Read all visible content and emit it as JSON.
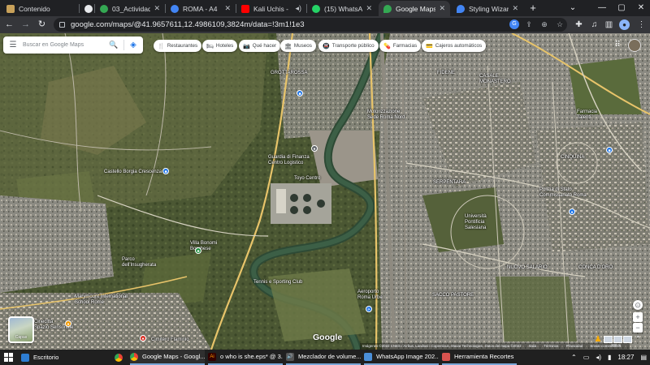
{
  "browser": {
    "tabs": [
      {
        "title": "Contenido",
        "fav_color": "#c8a15a",
        "fav_glyph": ""
      },
      {
        "title": "",
        "fav_color": "#e8eaed",
        "fav_glyph": ""
      },
      {
        "title": "03_Actividad_Ci",
        "fav_color": "#34a853",
        "fav_glyph": ""
      },
      {
        "title": "ROMA - A4",
        "fav_color": "#4285f4",
        "fav_glyph": ""
      },
      {
        "title": "Kali Uchis -",
        "fav_color": "#ff0000",
        "fav_glyph": ""
      },
      {
        "title": "(15) WhatsApp",
        "fav_color": "#25d366",
        "fav_glyph": ""
      },
      {
        "title": "Google Maps",
        "fav_color": "#34a853",
        "fav_glyph": ""
      },
      {
        "title": "Styling Wizard: G",
        "fav_color": "#4285f4",
        "fav_glyph": ""
      }
    ],
    "new_tab": "+",
    "window_controls": [
      "⌄",
      "—",
      "▢",
      "✕"
    ],
    "url": "google.com/maps/@41.9657611,12.4986109,3824m/data=!3m1!1e3"
  },
  "maps": {
    "search_placeholder": "Buscar en Google Maps",
    "chips": [
      {
        "icon": "fork-knife-icon",
        "glyph": "🍴",
        "label": "Restaurantes"
      },
      {
        "icon": "bed-icon",
        "glyph": "🛏",
        "label": "Hoteles"
      },
      {
        "icon": "camera-icon",
        "glyph": "📷",
        "label": "Qué hacer"
      },
      {
        "icon": "museum-icon",
        "glyph": "🏛",
        "label": "Museos"
      },
      {
        "icon": "transit-icon",
        "glyph": "🚇",
        "label": "Transporte público"
      },
      {
        "icon": "pharmacy-icon",
        "glyph": "💊",
        "label": "Farmacias"
      },
      {
        "icon": "atm-icon",
        "glyph": "💳",
        "label": "Cajeros automáticos"
      }
    ],
    "labels": {
      "grottarossa": "GROTTAROSSA",
      "ferrovia": "Motorizzazione\nSede Roma Nord",
      "guardia": "Guardia di Finanza\nCentro Logistico",
      "toyo": "Toyo Centro",
      "castello": "Castello Borgia Crescenza",
      "serpentara": "SERPENTARA",
      "polizia": "Polizia di Stato\nCommissariato Roma",
      "salesiani": "Università\nPontificia\nSalesiana",
      "parco": "Parco\ndell'Insugherata",
      "villa": "Villa Bonomi\nBorghese",
      "marymount": "Marymount International\nSchool Rome",
      "tennis": "Tennis e Sporting Club",
      "romaurbe": "Aeroporto\nRoma Urbe",
      "talenti": "Farmacia\nTalenti",
      "cinecitta": "Cinecittà\nSpazio Sensoriale",
      "cimitero": "Cimitero\nFlaminio",
      "fidene": "FIDENE",
      "casale": "CASALE\nMONASTERO",
      "cinquina": "CINQUINA",
      "conca": "CONCA D'ORO",
      "sacco": "SACCO PASTORE",
      "nuovo": "NUOVO SALARIO"
    },
    "layers_label": "Capas",
    "logo": "Google",
    "attribution": [
      "Imágenes ©2022 CNES / Airbus, Landsat / Copernicus, Maxar Technologies, Datos del mapa ©2022",
      "Italia",
      "Términos",
      "Privacidad",
      "Enviar comentarios",
      "200 m"
    ]
  },
  "taskbar": {
    "items": [
      {
        "label": "Escritorio",
        "color": "#2d7dd2",
        "glyph": ""
      },
      {
        "label": "",
        "color": "#34a853",
        "glyph": ""
      },
      {
        "label": "Google Maps - Googl...",
        "color": "#34a853",
        "glyph": ""
      },
      {
        "label": "o who is she.eps* @ 3...",
        "color": "#ff9a00",
        "glyph": "Ai"
      },
      {
        "label": "Mezclador de volume...",
        "color": "#888888",
        "glyph": "🔊"
      },
      {
        "label": "WhatsApp Image 202...",
        "color": "#4a8fd9",
        "glyph": ""
      },
      {
        "label": "Herramienta Recortes",
        "color": "#d9534f",
        "glyph": ""
      }
    ],
    "clock": "18:27"
  }
}
